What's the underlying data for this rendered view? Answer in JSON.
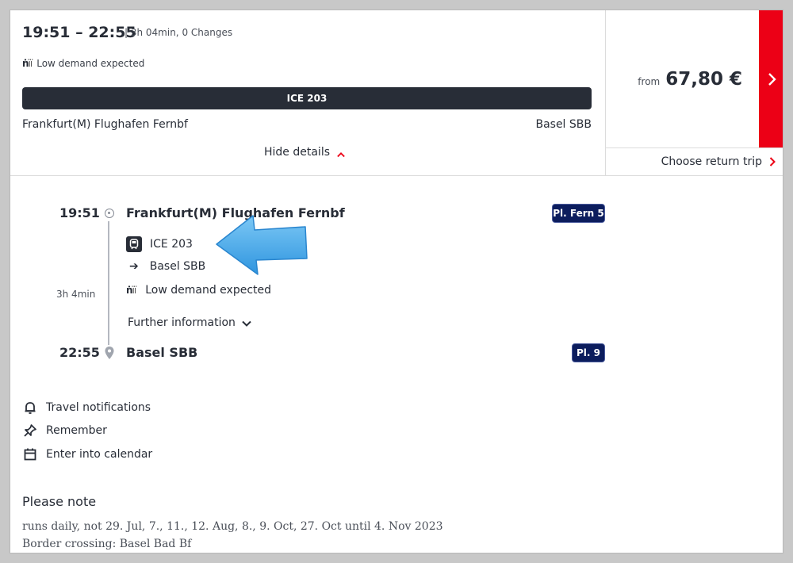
{
  "summary": {
    "times": "19:51 – 22:55",
    "meta": "| 3h 04min, 0 Changes",
    "demand": "Low demand expected",
    "train": "ICE 203",
    "from_station": "Frankfurt(M) Flughafen Fernbf",
    "to_station": "Basel SBB",
    "hide_details": "Hide details"
  },
  "price": {
    "from_label": "from",
    "value": "67,80 €",
    "return_label": "Choose return trip"
  },
  "journey": {
    "departure": {
      "time": "19:51",
      "station": "Frankfurt(M) Flughafen Fernbf",
      "platform": "Pl. Fern 5"
    },
    "duration": "3h 4min",
    "train": "ICE 203",
    "direction": "Basel SBB",
    "demand": "Low demand expected",
    "further_info": "Further information",
    "arrival": {
      "time": "22:55",
      "station": "Basel SBB",
      "platform": "Pl. 9"
    }
  },
  "actions": [
    {
      "label": "Travel notifications",
      "icon": "bell-icon"
    },
    {
      "label": "Remember",
      "icon": "pin-icon"
    },
    {
      "label": "Enter into calendar",
      "icon": "calendar-icon"
    }
  ],
  "notes": {
    "title": "Please note",
    "lines": [
      "runs daily, not 29. Jul, 7., 11., 12. Aug, 8., 9. Oct, 27. Oct until 4. Nov 2023",
      "Border crossing: Basel Bad Bf"
    ]
  },
  "colors": {
    "accent_red": "#ec0016",
    "dark": "#282d37",
    "platform_blue": "#0c1d5d",
    "arrow_blue": "#3aa5e8"
  }
}
